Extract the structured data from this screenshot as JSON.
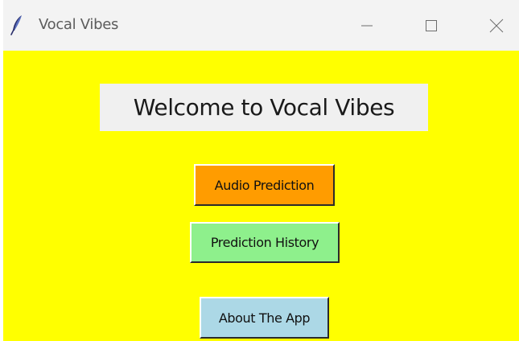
{
  "window": {
    "title": "Vocal Vibes",
    "app_icon": "feather-icon",
    "controls": {
      "minimize_icon": "minimize-icon",
      "maximize_icon": "maximize-icon",
      "close_icon": "close-icon"
    }
  },
  "main": {
    "background_color": "#ffff00",
    "welcome_text": "Welcome to Vocal Vibes",
    "welcome_background": "#f0f0f0",
    "buttons": {
      "audio_prediction": {
        "label": "Audio Prediction",
        "color": "#ff9c00"
      },
      "prediction_history": {
        "label": "Prediction History",
        "color": "#8ef08c"
      },
      "about": {
        "label": "About The App",
        "color": "#acd8e6"
      }
    }
  }
}
